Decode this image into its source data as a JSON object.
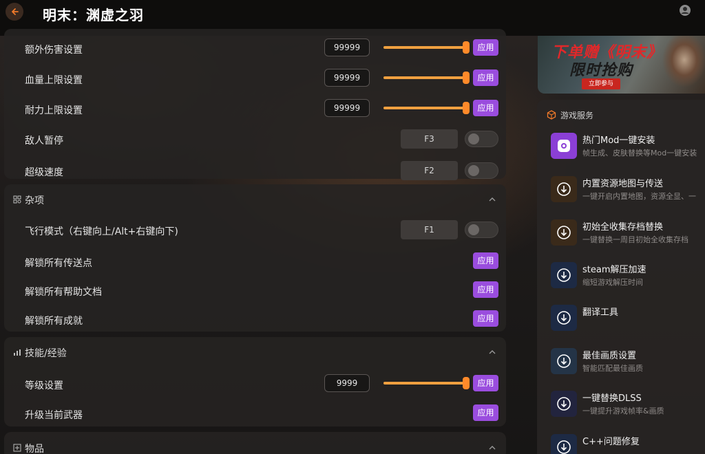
{
  "header": {
    "title": "明末：渊虚之羽",
    "back_icon": "back-arrow-icon",
    "user_icon": "user-icon",
    "accent": "#f07a2a"
  },
  "colors": {
    "apply_button": "#9a4dde",
    "slider_fill": "#f0a040",
    "slider_knob": "#ff8a2a"
  },
  "sections": {
    "top": {
      "rows": [
        {
          "label": "额外伤害设置",
          "value": "99999",
          "slider_fraction": 1.0,
          "apply": "应用"
        },
        {
          "label": "血量上限设置",
          "value": "99999",
          "slider_fraction": 1.0,
          "apply": "应用"
        },
        {
          "label": "耐力上限设置",
          "value": "99999",
          "slider_fraction": 1.0,
          "apply": "应用"
        },
        {
          "label": "敌人暂停",
          "hotkey": "F3",
          "toggle_on": false
        },
        {
          "label": "超级速度",
          "hotkey": "F2",
          "toggle_on": false
        }
      ]
    },
    "misc": {
      "title": "杂项",
      "icon": "grid-icon",
      "rows": [
        {
          "label": "飞行模式（右键向上/Alt+右键向下)",
          "hotkey": "F1",
          "toggle_on": false
        },
        {
          "label": "解锁所有传送点",
          "apply": "应用"
        },
        {
          "label": "解锁所有帮助文档",
          "apply": "应用"
        },
        {
          "label": "解锁所有成就",
          "apply": "应用"
        }
      ]
    },
    "skills": {
      "title": "技能/经验",
      "icon": "bar-chart-icon",
      "rows": [
        {
          "label": "等级设置",
          "value": "9999",
          "slider_fraction": 1.0,
          "apply": "应用"
        },
        {
          "label": "升级当前武器",
          "apply": "应用"
        }
      ]
    },
    "items": {
      "title": "物品",
      "icon": "box-plus-icon"
    }
  },
  "banner": {
    "line1": "下单赠《明末》",
    "line2": "限时抢购",
    "button": "立即参与"
  },
  "services": {
    "title": "游戏服务",
    "items": [
      {
        "name": "热门Mod一键安装",
        "desc": "帧生成、皮肤替换等Mod一键安装",
        "icon": "mod-icon",
        "thumb_color": "#8b3fd6"
      },
      {
        "name": "内置资源地图与传送",
        "desc": "一键开启内置地图，资源全显、一",
        "icon": "download-icon",
        "thumb_color": "#3a2a1a"
      },
      {
        "name": "初始全收集存档替换",
        "desc": "一键替换一周目初始全收集存档",
        "icon": "download-icon",
        "thumb_color": "#3a2a1a"
      },
      {
        "name": "steam解压加速",
        "desc": "缩短游戏解压时间",
        "icon": "download-icon",
        "thumb_color": "#1d2a44"
      },
      {
        "name": "翻译工具",
        "desc": "",
        "icon": "download-icon",
        "thumb_color": "#1d2a44"
      },
      {
        "name": "最佳画质设置",
        "desc": "智能匹配最佳画质",
        "icon": "download-icon",
        "thumb_color": "#243447"
      },
      {
        "name": "一键替换DLSS",
        "desc": "一键提升游戏帧率&画质",
        "icon": "download-icon",
        "thumb_color": "#22243e"
      },
      {
        "name": "C++问题修复",
        "desc": "",
        "icon": "download-icon",
        "thumb_color": "#1d2a44"
      }
    ]
  }
}
